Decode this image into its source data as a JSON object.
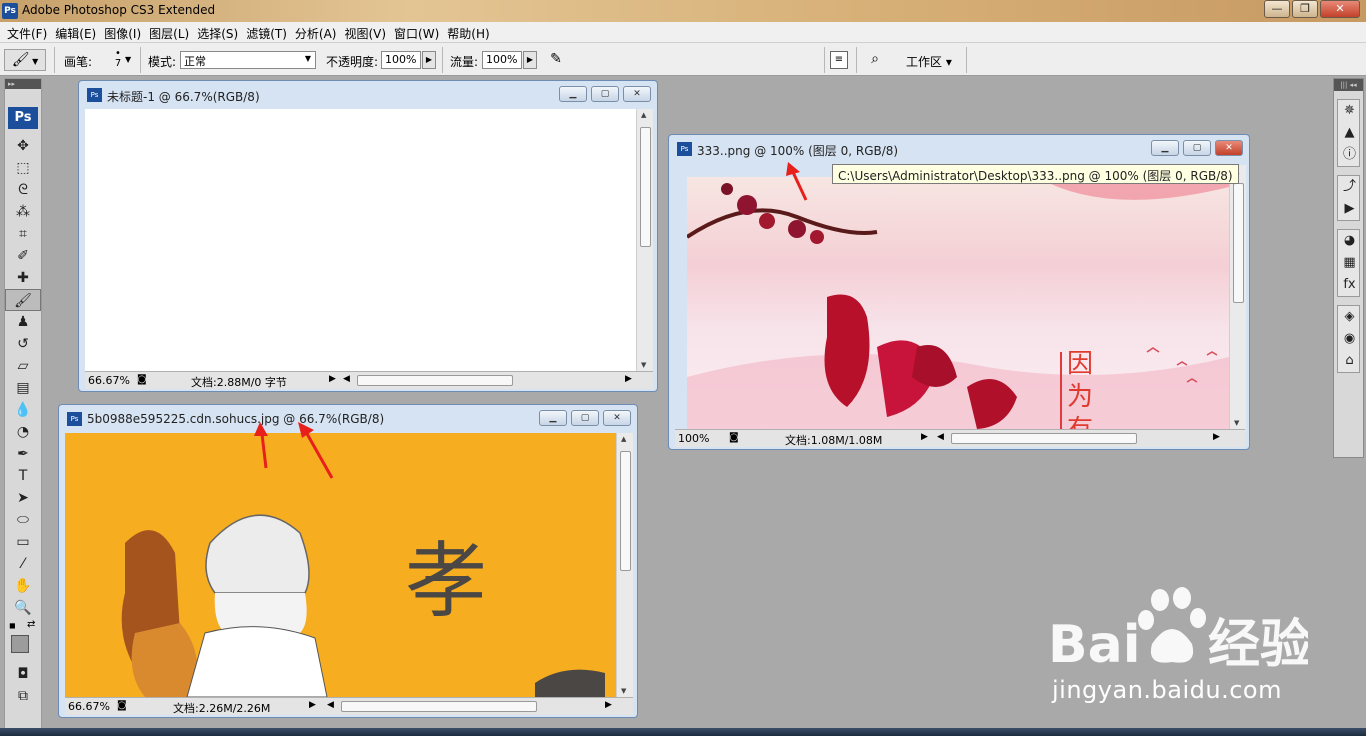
{
  "app": {
    "title": "Adobe Photoshop CS3 Extended",
    "window_buttons": {
      "minimize": "—",
      "maximize": "❐",
      "close": "✕"
    }
  },
  "menu": [
    "文件(F)",
    "编辑(E)",
    "图像(I)",
    "图层(L)",
    "选择(S)",
    "滤镜(T)",
    "分析(A)",
    "视图(V)",
    "窗口(W)",
    "帮助(H)"
  ],
  "options": {
    "brush_label": "画笔:",
    "brush_size": "7",
    "mode_label": "模式:",
    "mode_value": "正常",
    "opacity_label": "不透明度:",
    "opacity_value": "100%",
    "flow_label": "流量:",
    "flow_value": "100%",
    "workspace_label": "工作区 ▾"
  },
  "toolbox": {
    "logo": "Ps",
    "tools": [
      "move-tool",
      "marquee-tool",
      "lasso-tool",
      "magic-wand-tool",
      "crop-tool",
      "slice-tool",
      "healing-brush-tool",
      "brush-tool",
      "clone-stamp-tool",
      "history-brush-tool",
      "eraser-tool",
      "gradient-tool",
      "blur-tool",
      "dodge-tool",
      "pen-tool",
      "type-tool",
      "path-selection-tool",
      "shape-tool",
      "notes-tool",
      "eyedropper-tool",
      "hand-tool",
      "zoom-tool"
    ],
    "selected": "brush-tool"
  },
  "documents": {
    "untitled": {
      "title": "未标题-1 @ 66.7%(RGB/8)",
      "zoom": "66.67%",
      "status": "文档:2.88M/0 字节"
    },
    "png333": {
      "title": "333..png @ 100% (图层 0, RGB/8)",
      "zoom": "100%",
      "status": "文档:1.08M/1.08M",
      "canvas_text": "因为有"
    },
    "jpg": {
      "title": "5b0988e595225.cdn.sohucs.jpg @ 66.7%(RGB/8)",
      "zoom": "66.67%",
      "status": "文档:2.26M/2.26M",
      "canvas_text": "孝"
    }
  },
  "tooltip": "C:\\Users\\Administrator\\Desktop\\333..png @ 100% (图层 0, RGB/8)",
  "watermark": {
    "brand": "Bai du 经验",
    "url": "jingyan.baidu.com"
  },
  "colors": {
    "workspace_bg": "#a9a9a9",
    "doc_frame": "#d6e3f2",
    "arrow_red": "#e8201c",
    "canvas_orange": "#f6ad1f"
  }
}
